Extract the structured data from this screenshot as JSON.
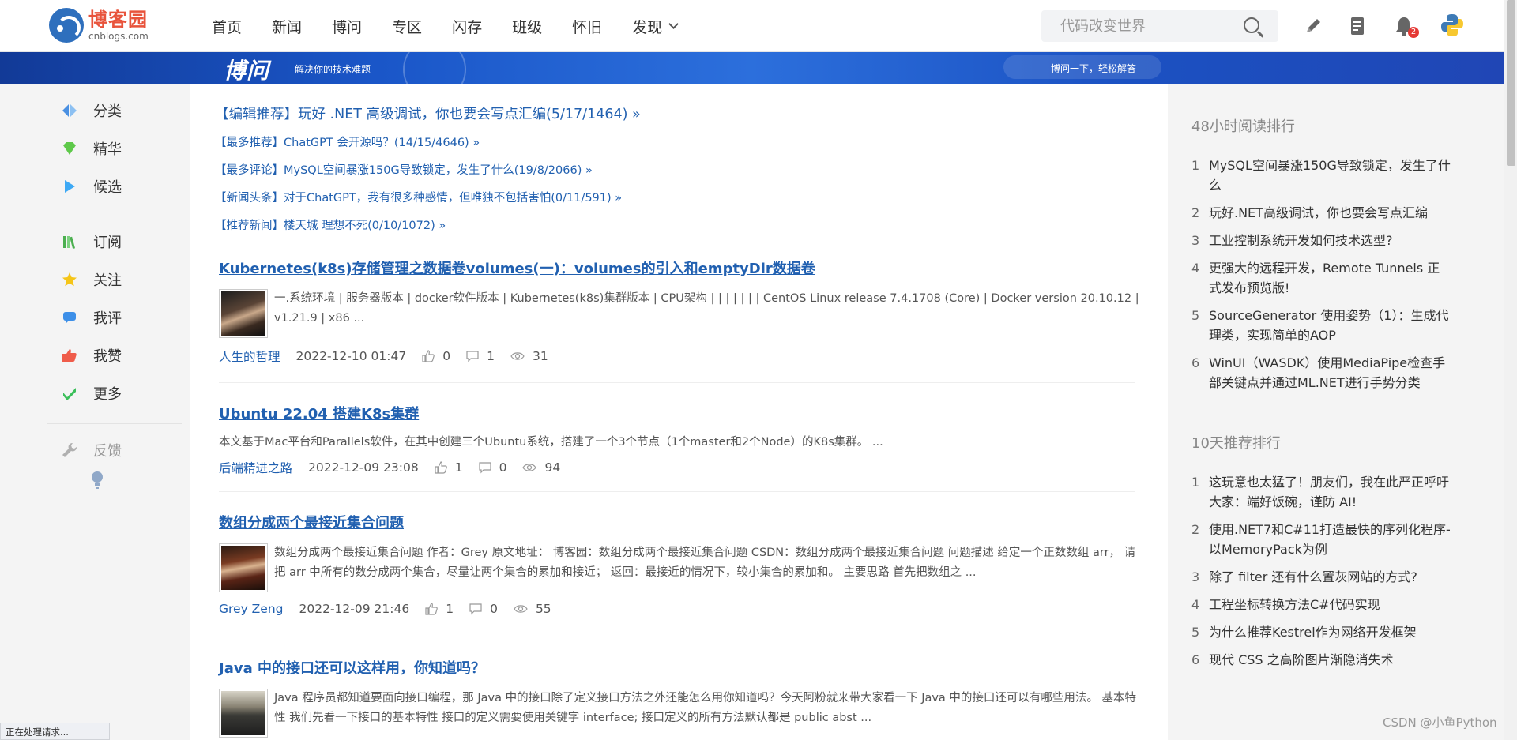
{
  "header": {
    "logo_cn": "博客园",
    "logo_en": "cnblogs.com",
    "nav": [
      "首页",
      "新闻",
      "博问",
      "专区",
      "闪存",
      "班级",
      "怀旧",
      "发现"
    ],
    "search_placeholder": "代码改变世界",
    "notification_count": "2"
  },
  "banner": {
    "logo": "博问",
    "subtitle": "解决你的技术难题",
    "slogan": "博问一下，轻松解答"
  },
  "sidebar": {
    "group1": [
      {
        "label": "分类",
        "icon": "category-icon",
        "color": "#4a90e2"
      },
      {
        "label": "精华",
        "icon": "gem-icon",
        "color": "#5ec94a"
      },
      {
        "label": "候选",
        "icon": "play-icon",
        "color": "#3da9f5"
      }
    ],
    "group2": [
      {
        "label": "订阅",
        "icon": "books-icon",
        "color": "#4caf50"
      },
      {
        "label": "关注",
        "icon": "star-icon",
        "color": "#f5c518"
      },
      {
        "label": "我评",
        "icon": "comment-icon",
        "color": "#3d8fe8"
      },
      {
        "label": "我赞",
        "icon": "thumbs-up-icon",
        "color": "#ef5c4a"
      },
      {
        "label": "更多",
        "icon": "check-icon",
        "color": "#3bbf5a"
      }
    ],
    "feedback": {
      "label": "反馈",
      "icon": "wrench-icon"
    },
    "tip_icon": "lightbulb-icon"
  },
  "featured": [
    "【编辑推荐】玩好 .NET 高级调试，你也要会写点汇编(5/17/1464) »",
    "【最多推荐】ChatGPT 会开源吗？(14/15/4646) »",
    "【最多评论】MySQL空间暴涨150G导致锁定，发生了什么(19/8/2066) »",
    "【新闻头条】对于ChatGPT，我有很多种感情，但唯独不包括害怕(0/11/591) »",
    "【推荐新闻】楼天城 理想不死(0/10/1072) »"
  ],
  "posts": [
    {
      "title": "Kubernetes(k8s)存储管理之数据卷volumes(一)：volumes的引入和emptyDir数据卷",
      "excerpt": "一.系统环境 | 服务器版本 | docker软件版本 | Kubernetes(k8s)集群版本 | CPU架构 | | | | | | | CentOS Linux release 7.4.1708 (Core) | Docker version 20.10.12 | v1.21.9 | x86 ...",
      "author": "人生的哲理",
      "date": "2022-12-10 01:47",
      "likes": "0",
      "comments": "1",
      "views": "31",
      "has_thumb": true
    },
    {
      "title": "Ubuntu 22.04 搭建K8s集群",
      "excerpt": "本文基于Mac平台和Parallels软件，在其中创建三个Ubuntu系统，搭建了一个3个节点（1个master和2个Node）的K8s集群。 ...",
      "author": "后端精进之路",
      "date": "2022-12-09 23:08",
      "likes": "1",
      "comments": "0",
      "views": "94",
      "has_thumb": false
    },
    {
      "title": "数组分成两个最接近集合问题",
      "excerpt": "数组分成两个最接近集合问题 作者：Grey 原文地址： 博客园：数组分成两个最接近集合问题 CSDN：数组分成两个最接近集合问题 问题描述 给定一个正数数组 arr， 请把 arr 中所有的数分成两个集合，尽量让两个集合的累加和接近； 返回：最接近的情况下，较小集合的累加和。 主要思路 首先把数组之 ...",
      "author": "Grey Zeng",
      "date": "2022-12-09 21:46",
      "likes": "1",
      "comments": "0",
      "views": "55",
      "has_thumb": true
    },
    {
      "title": "Java 中的接口还可以这样用，你知道吗？",
      "excerpt": "Java 程序员都知道要面向接口编程，那 Java 中的接口除了定义接口方法之外还能怎么用你知道吗？今天阿粉就来带大家看一下 Java 中的接口还可以有哪些用法。 基本特性 我们先看一下接口的基本特性 接口的定义需要使用关键字 interface; 接口定义的所有方法默认都是 public abst ...",
      "has_thumb": true
    }
  ],
  "right": {
    "rank48_title": "48小时阅读排行",
    "rank48": [
      "MySQL空间暴涨150G导致锁定，发生了什么",
      "玩好.NET高级调试，你也要会写点汇编",
      "工业控制系统开发如何技术选型?",
      "更强大的远程开发，Remote Tunnels 正式发布预览版!",
      "SourceGenerator 使用姿势（1）：生成代理类，实现简单的AOP",
      "WinUI（WASDK）使用MediaPipe检查手部关键点并通过ML.NET进行手势分类"
    ],
    "rank10_title": "10天推荐排行",
    "rank10": [
      "这玩意也太猛了！朋友们，我在此严正呼吁大家：端好饭碗，谨防 AI!",
      "使用.NET7和C#11打造最快的序列化程序-以MemoryPack为例",
      "除了 filter 还有什么置灰网站的方式?",
      "工程坐标转换方法C#代码实现",
      "为什么推荐Kestrel作为网络开发框架",
      "现代 CSS 之高阶图片渐隐消失术"
    ]
  },
  "status_text": "正在处理请求...",
  "watermark": "CSDN @小鱼Python"
}
